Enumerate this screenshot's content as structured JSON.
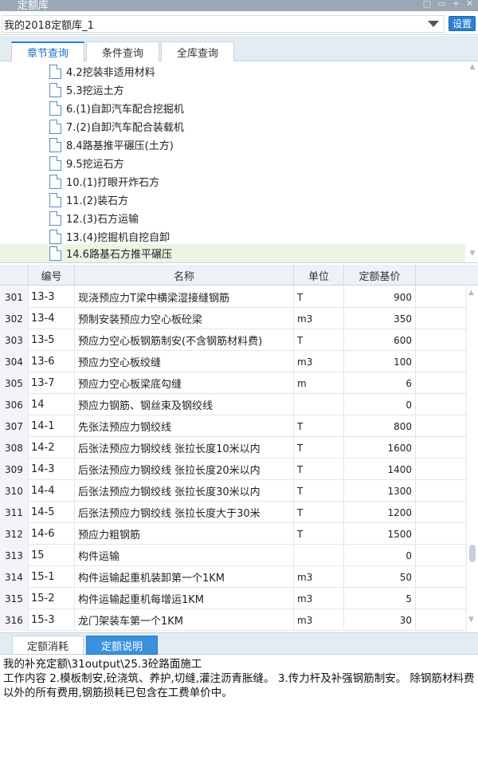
{
  "window": {
    "title": "定额库"
  },
  "library": {
    "selected": "我的2018定额库_1",
    "settings_label": "设置"
  },
  "tabs": [
    {
      "label": "章节查询",
      "active": true
    },
    {
      "label": "条件查询",
      "active": false
    },
    {
      "label": "全库查询",
      "active": false
    }
  ],
  "tree_items": [
    {
      "label": "4.2挖装非适用材料"
    },
    {
      "label": "5.3挖运土方"
    },
    {
      "label": "6.(1)自卸汽车配合挖掘机"
    },
    {
      "label": "7.(2)自卸汽车配合装载机"
    },
    {
      "label": "8.4路基推平碾压(土方)"
    },
    {
      "label": "9.5挖运石方"
    },
    {
      "label": "10.(1)打眼开炸石方"
    },
    {
      "label": "11.(2)装石方"
    },
    {
      "label": "12.(3)石方运输"
    },
    {
      "label": "13.(4)挖掘机自挖自卸"
    },
    {
      "label": "14.6路基石方推平碾压",
      "selected": true
    }
  ],
  "grid": {
    "columns": {
      "code": "编号",
      "name": "名称",
      "unit": "单位",
      "price": "定额基价"
    },
    "rows": [
      {
        "idx": "301",
        "code": "13-3",
        "name": "现浇预应力T梁中横梁湿接缝钢筋",
        "unit": "T",
        "price": "900"
      },
      {
        "idx": "302",
        "code": "13-4",
        "name": "预制安装预应力空心板砼梁",
        "unit": "m3",
        "price": "350"
      },
      {
        "idx": "303",
        "code": "13-5",
        "name": "预应力空心板钢筋制安(不含钢筋材料费)",
        "unit": "T",
        "price": "600"
      },
      {
        "idx": "304",
        "code": "13-6",
        "name": "预应力空心板绞缝",
        "unit": "m3",
        "price": "100"
      },
      {
        "idx": "305",
        "code": "13-7",
        "name": "预应力空心板梁底勾缝",
        "unit": "m",
        "price": "6"
      },
      {
        "idx": "306",
        "code": "14",
        "name": "预应力钢筋、钢丝束及钢绞线",
        "unit": "",
        "price": "0"
      },
      {
        "idx": "307",
        "code": "14-1",
        "name": "先张法预应力钢绞线",
        "unit": "T",
        "price": "800"
      },
      {
        "idx": "308",
        "code": "14-2",
        "name": "后张法预应力钢绞线 张拉长度10米以内",
        "unit": "T",
        "price": "1600"
      },
      {
        "idx": "309",
        "code": "14-3",
        "name": "后张法预应力钢绞线 张拉长度20米以内",
        "unit": "T",
        "price": "1400"
      },
      {
        "idx": "310",
        "code": "14-4",
        "name": "后张法预应力钢绞线 张拉长度30米以内",
        "unit": "T",
        "price": "1300"
      },
      {
        "idx": "311",
        "code": "14-5",
        "name": "后张法预应力钢绞线 张拉长度大于30米",
        "unit": "T",
        "price": "1200"
      },
      {
        "idx": "312",
        "code": "14-6",
        "name": "预应力粗钢筋",
        "unit": "T",
        "price": "1500"
      },
      {
        "idx": "313",
        "code": "15",
        "name": "构件运输",
        "unit": "",
        "price": "0"
      },
      {
        "idx": "314",
        "code": "15-1",
        "name": "构件运输起重机装卸第一个1KM",
        "unit": "m3",
        "price": "50"
      },
      {
        "idx": "315",
        "code": "15-2",
        "name": "构件运输起重机每增运1KM",
        "unit": "m3",
        "price": "5"
      },
      {
        "idx": "316",
        "code": "15-3",
        "name": "龙门架装车第一个1KM",
        "unit": "m3",
        "price": "30"
      }
    ]
  },
  "bottom_tabs": [
    {
      "label": "定额消耗",
      "active": false
    },
    {
      "label": "定额说明",
      "active": true
    }
  ],
  "description": {
    "line1": "我的补充定额\\31output\\25.3砼路面施工",
    "line2": "工作内容 2.模板制安,砼浇筑、养护,切缝,灌注沥青胀缝。 3.传力杆及补强钢筋制安。 除钢筋材料费以外的所有费用,钢筋损耗已包含在工费单价中。"
  }
}
